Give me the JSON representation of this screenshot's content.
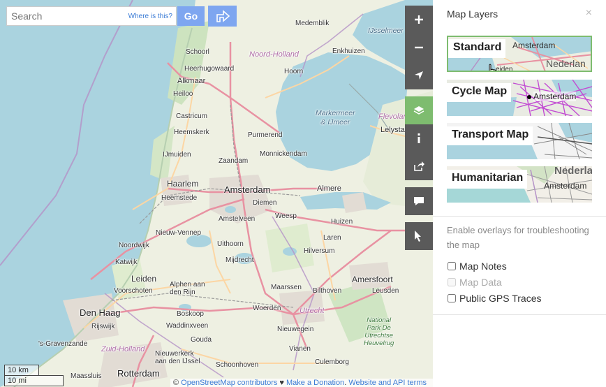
{
  "search": {
    "placeholder": "Search",
    "where_link": "Where is this?",
    "go_label": "Go"
  },
  "controls": {
    "icons": [
      "plus-icon",
      "minus-icon",
      "locate-icon",
      "layers-icon",
      "info-icon",
      "share-icon",
      "note-icon",
      "query-icon"
    ]
  },
  "panel": {
    "title": "Map Layers",
    "close": "×",
    "layers": [
      {
        "label": "Standard",
        "selected": true,
        "thumb_labels": [
          "Amsterdam",
          "Nederlan",
          "eiden"
        ]
      },
      {
        "label": "Cycle Map",
        "selected": false,
        "thumb_labels": [
          "Amsterdam"
        ]
      },
      {
        "label": "Transport Map",
        "selected": false,
        "thumb_labels": []
      },
      {
        "label": "Humanitarian",
        "selected": false,
        "thumb_labels": [
          "Nederla",
          "Amsterdam"
        ]
      }
    ],
    "overlay_intro": "Enable overlays for troubleshooting the map",
    "overlays": [
      {
        "label": "Map Notes",
        "checked": false,
        "disabled": false
      },
      {
        "label": "Map Data",
        "checked": false,
        "disabled": true
      },
      {
        "label": "Public GPS Traces",
        "checked": false,
        "disabled": false
      }
    ]
  },
  "map": {
    "places": {
      "medemblik": "Medemblik",
      "ijsselmeer": "IJsselmeer",
      "schoorl": "Schoorl",
      "noord_holland": "Noord-Holland",
      "enkhuizen": "Enkhuizen",
      "heerhugowaard": "Heerhugowaard",
      "alkmaar": "Alkmaar",
      "hoorn": "Hoorn",
      "heiloo": "Heiloo",
      "markermeer": "Markermeer\n& IJmeer",
      "flevolan": "Flevolan",
      "castricum": "Castricum",
      "heemskerk": "Heemskerk",
      "purmerend": "Purmerend",
      "lelystad": "Lelystad",
      "ijmuiden": "IJmuiden",
      "monnickendam": "Monnickendam",
      "zaandam": "Zaandam",
      "haarlem": "Haarlem",
      "amsterdam": "Amsterdam",
      "almere": "Almere",
      "heemstede": "Heemstede",
      "diemen": "Diemen",
      "amstelveen": "Amstelveen",
      "weesp": "Weesp",
      "huizen": "Huizen",
      "nieuw_vennep": "Nieuw-Vennep",
      "noordwijk": "Noordwijk",
      "uithoorn": "Uithoorn",
      "laren": "Laren",
      "katwijk": "Katwijk",
      "mijdrecht": "Mijdrecht",
      "hilversum": "Hilversum",
      "leiden": "Leiden",
      "amersfoort": "Amersfoort",
      "voorschoten": "Voorschoten",
      "alphen": "Alphen aan\nden Rijn",
      "maarssen": "Maarssen",
      "bilthoven": "Bilthoven",
      "leusden": "Leusden",
      "den_haag": "Den Haag",
      "boskoop": "Boskoop",
      "woerden": "Woerden",
      "utrecht": "Utrecht",
      "rijswijk": "Rijswijk",
      "waddinxveen": "Waddinxveen",
      "nieuwegein": "Nieuwegein",
      "park": "National\nPark De\nUtrechtse\nHeuvelrug",
      "gravenzande": "'s-Gravenzande",
      "gouda": "Gouda",
      "zuid_holland": "Zuid-Holland",
      "vianen": "Vianen",
      "nieuwerkerk": "Nieuwerkerk\naan den IJssel",
      "rotterdam": "Rotterdam",
      "schoonhoven": "Schoonhoven",
      "culemborg": "Culemborg",
      "maassluis": "Maassluis"
    },
    "scale": {
      "km": "10 km",
      "mi": "10 mi"
    },
    "attribution": {
      "prefix": "© ",
      "osm": "OpenStreetMap contributors",
      "heart": " ♥ ",
      "donate": "Make a Donation",
      "sep": ". ",
      "website": "Website and API terms"
    }
  },
  "colors": {
    "accent": "#7ebc6f",
    "button": "#7ea6f0",
    "water": "#aad3df",
    "control": "#5a5a5a"
  }
}
